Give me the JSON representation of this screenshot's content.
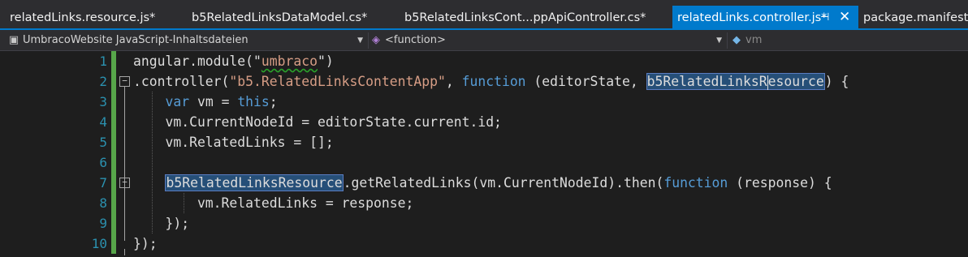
{
  "tabs": [
    {
      "label": "relatedLinks.resource.js*"
    },
    {
      "label": "b5RelatedLinksDataModel.cs*"
    },
    {
      "label": "b5RelatedLinksCont...ppApiController.cs*"
    },
    {
      "label": "relatedLinks.controller.js*",
      "pin": "⊣",
      "close": "✕"
    },
    {
      "label": "package.manifest"
    }
  ],
  "navbar": {
    "project": "UmbracoWebsite JavaScript-Inhaltsdateien",
    "scope": "<function>",
    "member": "vm"
  },
  "editor": {
    "line_numbers": [
      "1",
      "2",
      "3",
      "4",
      "5",
      "6",
      "7",
      "8",
      "9",
      "10"
    ],
    "lines": [
      {
        "segments": [
          {
            "t": "angular.module(\""
          },
          {
            "t": "umbraco",
            "cls": "str squig"
          },
          {
            "t": "\")"
          }
        ]
      },
      {
        "segments": [
          {
            "t": ".controller("
          },
          {
            "t": "\"b5.RelatedLinksContentApp\"",
            "cls": "str"
          },
          {
            "t": ", "
          },
          {
            "t": "function",
            "cls": "kw"
          },
          {
            "t": " (editorState, "
          },
          {
            "t": "b5RelatedLinksResource",
            "cls": "hl",
            "cursor_after": 15
          },
          {
            "t": ") {"
          }
        ]
      },
      {
        "segments": [
          {
            "t": "    "
          },
          {
            "t": "var",
            "cls": "kw"
          },
          {
            "t": " vm = "
          },
          {
            "t": "this",
            "cls": "kw"
          },
          {
            "t": ";"
          }
        ]
      },
      {
        "segments": [
          {
            "t": "    vm.CurrentNodeId = editorState.current.id;"
          }
        ]
      },
      {
        "segments": [
          {
            "t": "    vm.RelatedLinks = [];"
          }
        ]
      },
      {
        "segments": [
          {
            "t": ""
          }
        ]
      },
      {
        "segments": [
          {
            "t": "    "
          },
          {
            "t": "b5RelatedLinksResource",
            "cls": "hl"
          },
          {
            "t": ".getRelatedLinks(vm.CurrentNodeId).then("
          },
          {
            "t": "function",
            "cls": "kw"
          },
          {
            "t": " (response) {"
          }
        ]
      },
      {
        "segments": [
          {
            "t": "        vm.RelatedLinks = response;"
          }
        ]
      },
      {
        "segments": [
          {
            "t": "    });"
          }
        ]
      },
      {
        "segments": [
          {
            "t": "});"
          }
        ]
      }
    ],
    "fold_markers": {
      "2": "−",
      "7": "−"
    },
    "changed_lines": [
      1,
      2,
      3,
      4,
      5,
      6,
      7,
      8,
      9,
      10
    ]
  },
  "colors": {
    "background": "#1e1e1e",
    "keyword": "#569cd6",
    "string": "#d69d85",
    "line_number": "#2b91af",
    "accent": "#007acc",
    "change_bar": "#57a64a"
  }
}
